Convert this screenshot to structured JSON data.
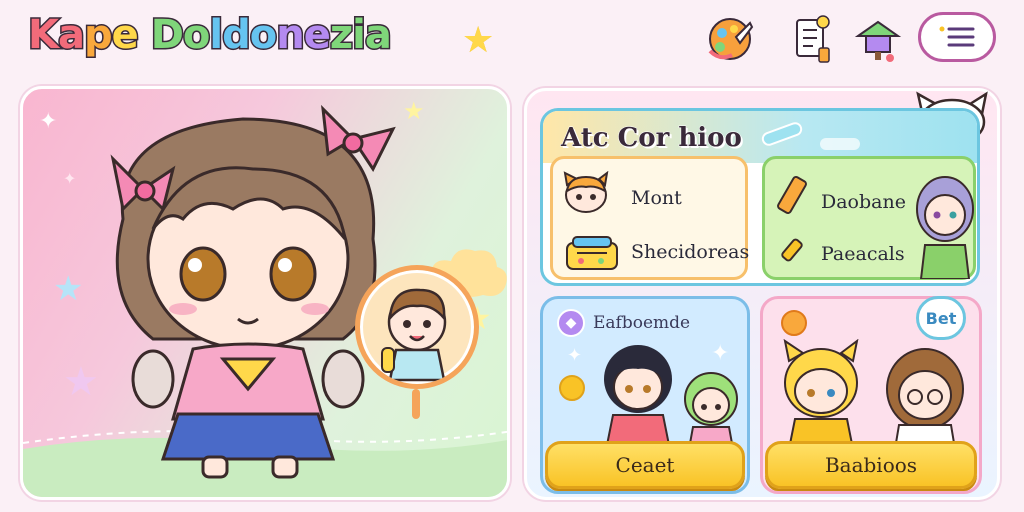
{
  "header": {
    "title_parts": [
      "Ka",
      "p",
      "e ",
      "Do",
      "ldo",
      "ne",
      "zia"
    ],
    "icons": [
      "palette-icon",
      "checklist-icon",
      "tree-icon"
    ],
    "menu_icon": "menu-icon"
  },
  "hero": {
    "character_icon": "anime-girl-avatar",
    "badge_icon": "chibi-boy-badge"
  },
  "panel": {
    "title": "Atc Cor hioo",
    "left_items": [
      {
        "icon": "cat-girl-icon",
        "label": "Mont"
      },
      {
        "icon": "basket-icon",
        "label": "Shecidoreas"
      }
    ],
    "right_items": [
      {
        "icon": "pencil-icon",
        "label": "Daobane"
      },
      {
        "icon": "pencil-small-icon",
        "label": "Paeacals"
      }
    ]
  },
  "cards": {
    "left": {
      "title": "Eafboemde",
      "button": "Ceaet"
    },
    "right": {
      "badge": "Bet",
      "button": "Baabioos"
    }
  },
  "colors": {
    "accent_pink": "#f26b7a",
    "accent_yellow": "#ffd84a",
    "accent_blue": "#6cc6e0",
    "accent_green": "#8ad06a"
  }
}
